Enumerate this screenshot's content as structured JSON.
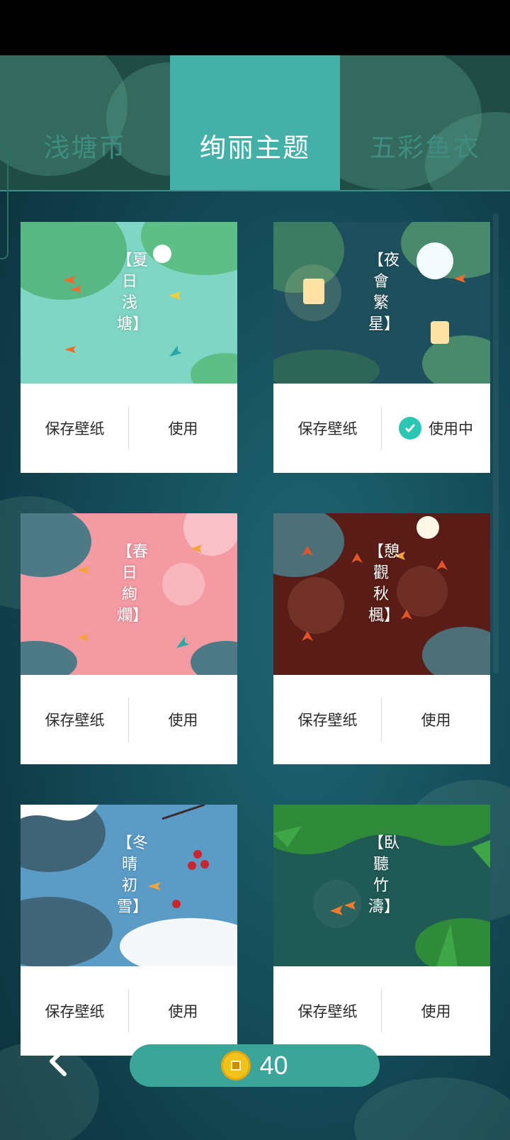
{
  "tabs": [
    {
      "label": "浅塘币",
      "active": false
    },
    {
      "label": "绚丽主题",
      "active": true
    },
    {
      "label": "五彩鱼衣",
      "active": false
    }
  ],
  "themes": [
    {
      "title": "【夏日浅塘】",
      "save_label": "保存壁纸",
      "use_label": "使用",
      "in_use": false
    },
    {
      "title": "【夜會繁星】",
      "save_label": "保存壁纸",
      "use_label": "使用中",
      "in_use": true
    },
    {
      "title": "【春日絢爛】",
      "save_label": "保存壁纸",
      "use_label": "使用",
      "in_use": false
    },
    {
      "title": "【憩觀秋楓】",
      "save_label": "保存壁纸",
      "use_label": "使用",
      "in_use": false
    },
    {
      "title": "【冬晴初雪】",
      "save_label": "保存壁纸",
      "use_label": "使用",
      "in_use": false
    },
    {
      "title": "【臥聽竹濤】",
      "save_label": "保存壁纸",
      "use_label": "使用",
      "in_use": false
    }
  ],
  "footer": {
    "coin_count": "40"
  },
  "colors": {
    "accent": "#44b0a7",
    "tab_bg": "#1f4d45",
    "check": "#2cc6b4",
    "coin": "#f2c21b"
  }
}
